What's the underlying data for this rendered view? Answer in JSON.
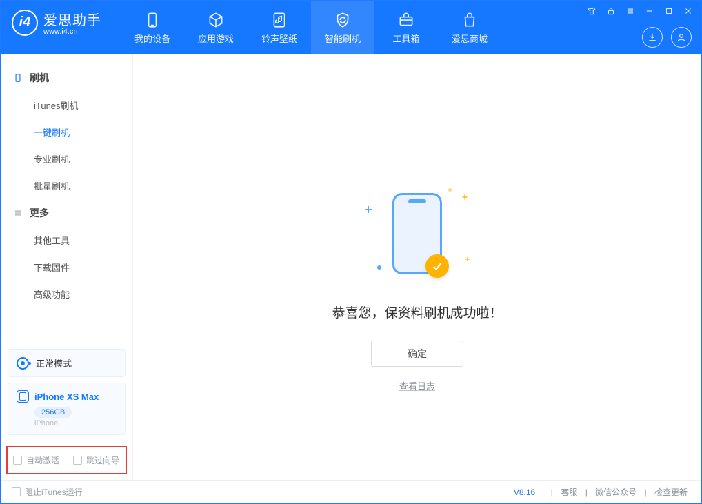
{
  "brand": {
    "name_cn": "爱思助手",
    "url": "www.i4.cn",
    "logo_letter": "i4"
  },
  "tabs": [
    {
      "label": "我的设备"
    },
    {
      "label": "应用游戏"
    },
    {
      "label": "铃声壁纸"
    },
    {
      "label": "智能刷机"
    },
    {
      "label": "工具箱"
    },
    {
      "label": "爱思商城"
    }
  ],
  "sidebar": {
    "sections": [
      {
        "title": "刷机",
        "items": [
          "iTunes刷机",
          "一键刷机",
          "专业刷机",
          "批量刷机"
        ]
      },
      {
        "title": "更多",
        "items": [
          "其他工具",
          "下载固件",
          "高级功能"
        ]
      }
    ]
  },
  "mode_card": {
    "label": "正常模式"
  },
  "device_card": {
    "name": "iPhone XS Max",
    "capacity": "256GB",
    "subtitle": "iPhone"
  },
  "options": {
    "auto_activate": "自动激活",
    "skip_guide": "跳过向导"
  },
  "main": {
    "success_message": "恭喜您，保资料刷机成功啦！",
    "confirm_label": "确定",
    "view_log_label": "查看日志"
  },
  "footer": {
    "block_itunes": "阻止iTunes运行",
    "version": "V8.16",
    "links": [
      "客服",
      "微信公众号",
      "检查更新"
    ]
  }
}
